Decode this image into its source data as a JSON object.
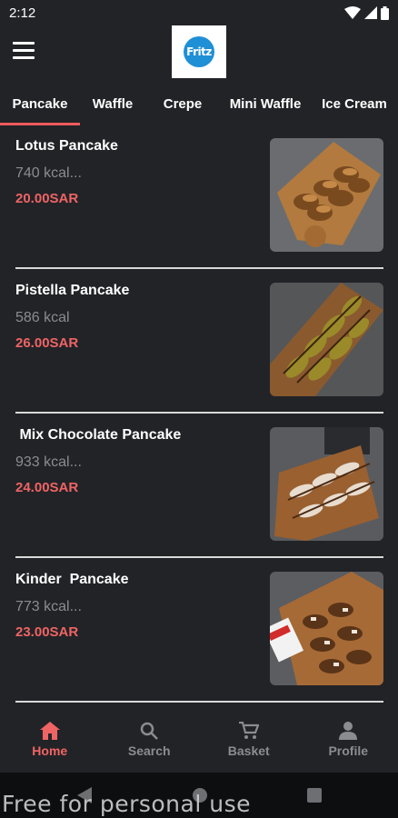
{
  "status": {
    "time": "2:12"
  },
  "header": {
    "menu_icon": "hamburger-menu-icon",
    "logo_text": "Fritz"
  },
  "tabs": [
    {
      "label": "Pancake",
      "active": true
    },
    {
      "label": "Waffle",
      "active": false
    },
    {
      "label": "Crepe",
      "active": false
    },
    {
      "label": "Mini Waffle",
      "active": false
    },
    {
      "label": "Ice Cream",
      "active": false
    }
  ],
  "items": [
    {
      "name": "Lotus Pancake",
      "kcal": "740 kcal...",
      "price": "20.00SAR",
      "image": "lotus-pancake-image"
    },
    {
      "name": "Pistella Pancake",
      "kcal": "586 kcal",
      "price": "26.00SAR",
      "image": "pistella-pancake-image"
    },
    {
      "name": " Mix Chocolate Pancake",
      "kcal": "933 kcal...",
      "price": "24.00SAR",
      "image": "mix-chocolate-pancake-image"
    },
    {
      "name": "Kinder  Pancake",
      "kcal": "773 kcal...",
      "price": "23.00SAR",
      "image": "kinder-pancake-image"
    }
  ],
  "bottom_nav": [
    {
      "label": "Home",
      "icon": "home-icon",
      "active": true
    },
    {
      "label": "Search",
      "icon": "search-icon",
      "active": false
    },
    {
      "label": "Basket",
      "icon": "cart-icon",
      "active": false
    },
    {
      "label": "Profile",
      "icon": "person-icon",
      "active": false
    }
  ],
  "watermark": "Free for personal use",
  "colors": {
    "accent": "#ef6464",
    "surface": "#222327",
    "muted": "#8b8c90"
  }
}
